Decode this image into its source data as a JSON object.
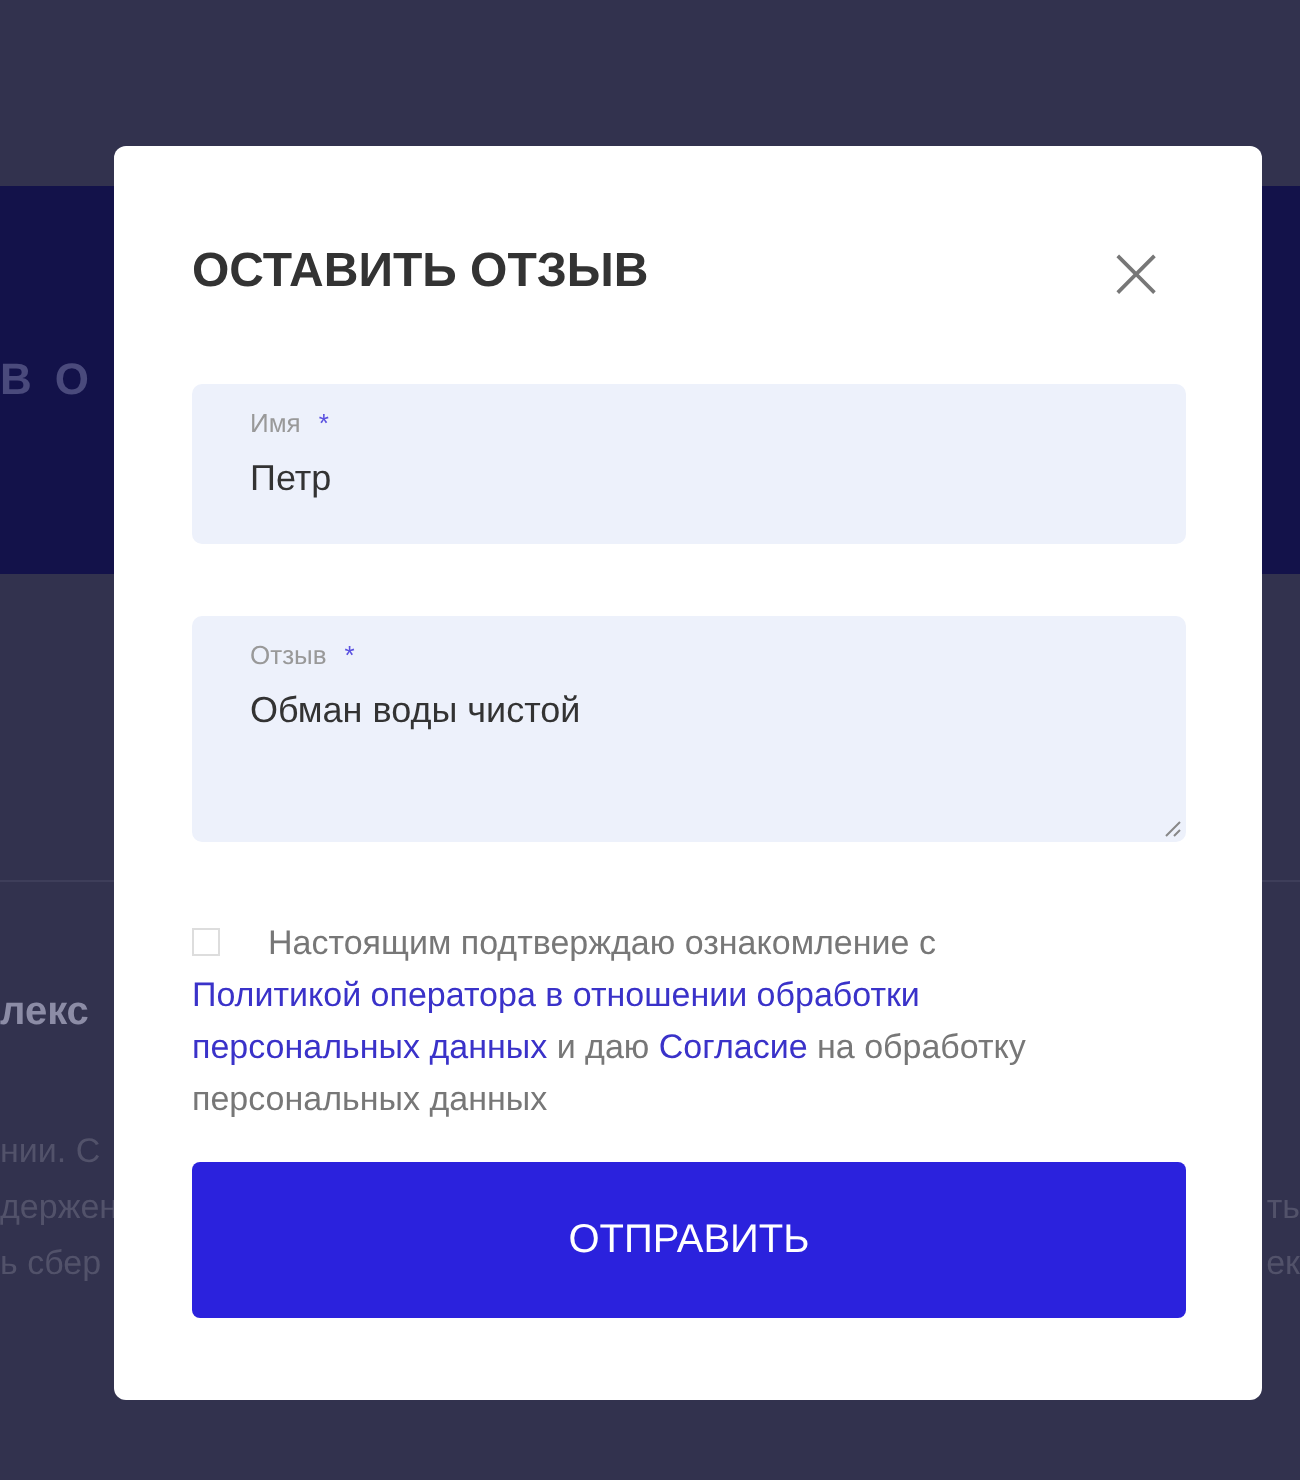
{
  "background": {
    "banner_text": "ВО",
    "author": "лекс",
    "left_lines": [
      "нии. С",
      "держен",
      "ь сбер"
    ],
    "right_lines": [
      "ть",
      "ек"
    ]
  },
  "dialog": {
    "title": "ОСТАВИТЬ ОТЗЫВ",
    "close": "×",
    "fields": [
      {
        "kind": "input",
        "label": "Имя",
        "required_mark": "*",
        "value": "Петр"
      },
      {
        "kind": "textarea",
        "label": "Отзыв",
        "required_mark": "*",
        "value": "Обман воды чистой"
      }
    ],
    "consent": {
      "checked": false,
      "parts": [
        {
          "kind": "text",
          "text": "Настоящим подтверждаю ознакомление с "
        },
        {
          "kind": "link",
          "text": "Политикой оператора в отношении обработки"
        },
        {
          "kind": "link",
          "text": "персональных данных"
        },
        {
          "kind": "text",
          "text": " и даю "
        },
        {
          "kind": "link",
          "text": "Согласие"
        },
        {
          "kind": "text",
          "text": " на обработку персональных данных"
        }
      ]
    },
    "submit": "ОТПРАВИТЬ"
  }
}
